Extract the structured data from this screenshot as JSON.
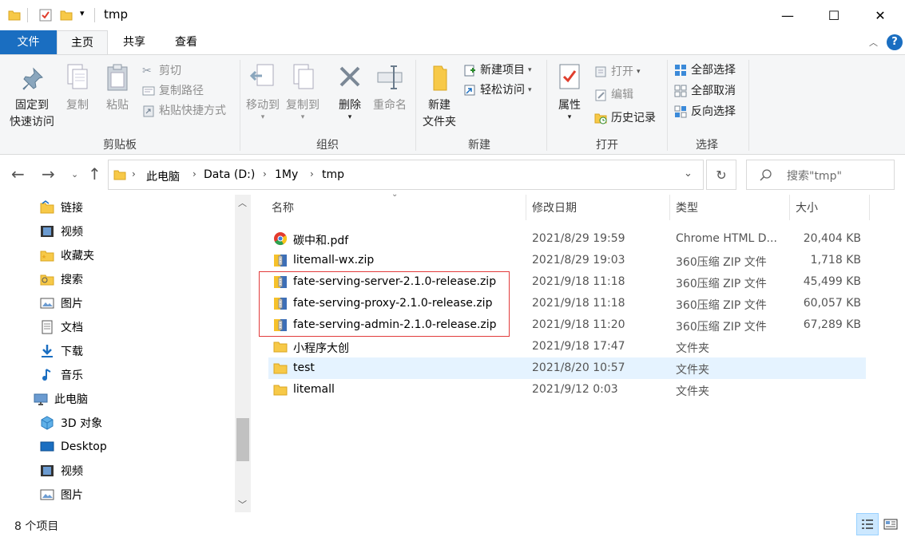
{
  "window": {
    "title": "tmp",
    "minimize": "—",
    "maximize": "☐",
    "close": "✕"
  },
  "tabs": [
    {
      "label": "文件"
    },
    {
      "label": "主页"
    },
    {
      "label": "共享"
    },
    {
      "label": "查看"
    }
  ],
  "help": "?",
  "ribbon": {
    "clipboard": {
      "pin_line1": "固定到",
      "pin_line2": "快速访问",
      "copy": "复制",
      "paste": "粘贴",
      "cut": "剪切",
      "copy_path": "复制路径",
      "paste_shortcut": "粘贴快捷方式",
      "label": "剪贴板"
    },
    "organize": {
      "move_to": "移动到",
      "copy_to": "复制到",
      "delete": "删除",
      "rename": "重命名",
      "label": "组织"
    },
    "new": {
      "new_folder_line1": "新建",
      "new_folder_line2": "文件夹",
      "new_item": "新建项目",
      "easy_access": "轻松访问",
      "label": "新建"
    },
    "open": {
      "properties": "属性",
      "open": "打开",
      "edit": "编辑",
      "history": "历史记录",
      "label": "打开"
    },
    "select": {
      "select_all": "全部选择",
      "select_none": "全部取消",
      "invert": "反向选择",
      "label": "选择"
    }
  },
  "address": {
    "crumbs": [
      "此电脑",
      "Data (D:)",
      "1My",
      "tmp"
    ],
    "search_placeholder": "搜索\"tmp\""
  },
  "nav": [
    {
      "label": "链接",
      "icon": "link-folder-icon"
    },
    {
      "label": "视频",
      "icon": "video-icon"
    },
    {
      "label": "收藏夹",
      "icon": "favorites-folder-icon"
    },
    {
      "label": "搜索",
      "icon": "search-folder-icon"
    },
    {
      "label": "图片",
      "icon": "pictures-icon"
    },
    {
      "label": "文档",
      "icon": "documents-icon"
    },
    {
      "label": "下载",
      "icon": "download-icon"
    },
    {
      "label": "音乐",
      "icon": "music-icon"
    },
    {
      "label": "此电脑",
      "icon": "computer-icon"
    },
    {
      "label": "3D 对象",
      "icon": "3d-objects-icon"
    },
    {
      "label": "Desktop",
      "icon": "desktop-icon"
    },
    {
      "label": "视频",
      "icon": "video-icon"
    },
    {
      "label": "图片",
      "icon": "pictures-icon"
    }
  ],
  "columns": {
    "name": "名称",
    "date": "修改日期",
    "type": "类型",
    "size": "大小"
  },
  "files": [
    {
      "name": "碳中和.pdf",
      "date": "2021/8/29 19:59",
      "type": "Chrome HTML D...",
      "size": "20,404 KB",
      "icon": "chrome-icon"
    },
    {
      "name": "litemall-wx.zip",
      "date": "2021/8/29 19:03",
      "type": "360压缩 ZIP 文件",
      "size": "1,718 KB",
      "icon": "zip-archive-icon"
    },
    {
      "name": "fate-serving-server-2.1.0-release.zip",
      "date": "2021/9/18 11:18",
      "type": "360压缩 ZIP 文件",
      "size": "45,499 KB",
      "icon": "zip-archive-icon"
    },
    {
      "name": "fate-serving-proxy-2.1.0-release.zip",
      "date": "2021/9/18 11:18",
      "type": "360压缩 ZIP 文件",
      "size": "60,057 KB",
      "icon": "zip-archive-icon"
    },
    {
      "name": "fate-serving-admin-2.1.0-release.zip",
      "date": "2021/9/18 11:20",
      "type": "360压缩 ZIP 文件",
      "size": "67,289 KB",
      "icon": "zip-archive-icon"
    },
    {
      "name": "小程序大创",
      "date": "2021/9/18 17:47",
      "type": "文件夹",
      "size": "",
      "icon": "folder-icon"
    },
    {
      "name": "test",
      "date": "2021/8/20 10:57",
      "type": "文件夹",
      "size": "",
      "icon": "folder-icon",
      "selected": true
    },
    {
      "name": "litemall",
      "date": "2021/9/12 0:03",
      "type": "文件夹",
      "size": "",
      "icon": "folder-icon"
    }
  ],
  "status": {
    "count": "8 个项目"
  },
  "colors": {
    "accent": "#1a6ec1",
    "selection": "#e5f3ff",
    "highlight_box": "#e23b3b"
  }
}
